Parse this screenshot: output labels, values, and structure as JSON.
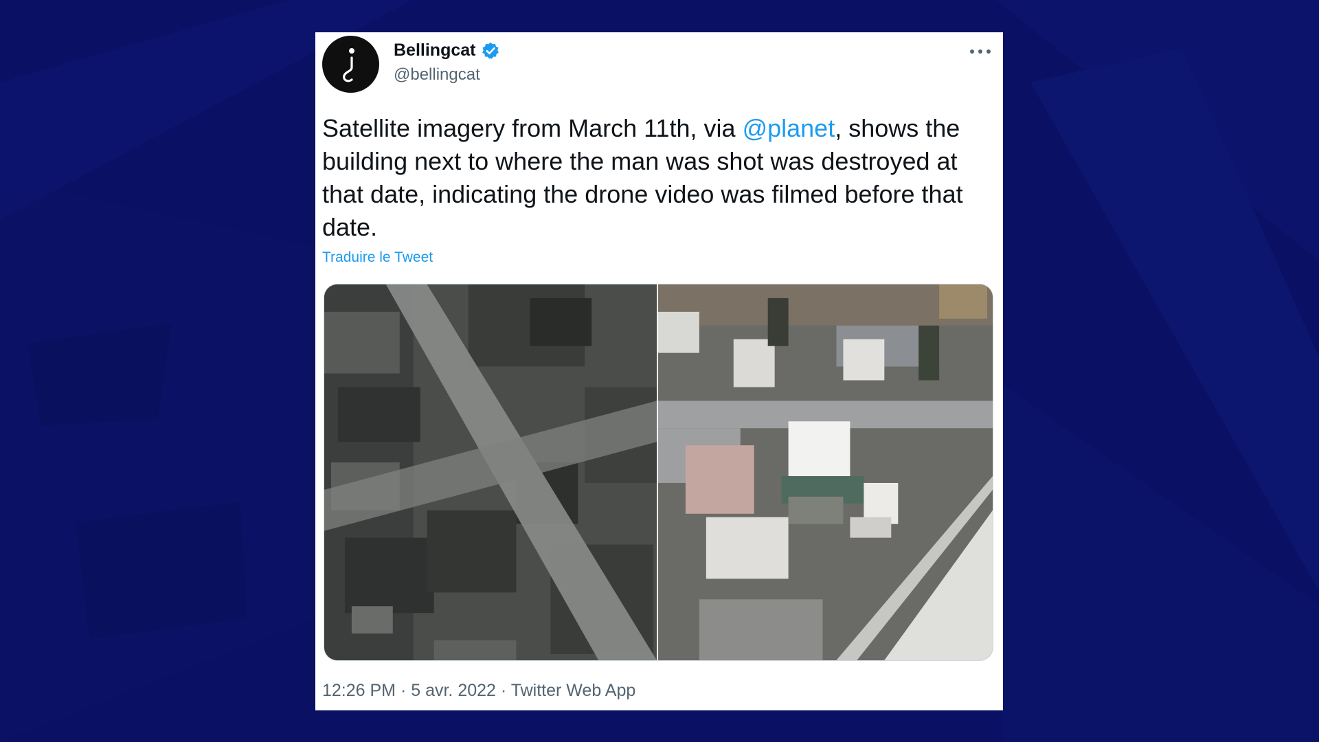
{
  "colors": {
    "page_background": "#0a1063",
    "accent": "#1d9bf0",
    "text_primary": "#0f1419",
    "text_secondary": "#536471"
  },
  "tweet": {
    "author": {
      "display_name": "Bellingcat",
      "handle": "@bellingcat",
      "verified": true,
      "avatar_icon": "question-hook-logo"
    },
    "more_icon": "ellipsis-icon",
    "text_parts": {
      "before_mention": "Satellite imagery from March 11th, via ",
      "mention": "@planet",
      "after_mention": ", shows the building next to where the man was shot was destroyed at that date, indicating the drone video was filmed before that date."
    },
    "translate_label": "Traduire le Tweet",
    "media": [
      {
        "kind": "satellite-image"
      },
      {
        "kind": "drone-video-still"
      }
    ],
    "meta": {
      "time": "12:26 PM",
      "separator_1": " · ",
      "date": "5 avr. 2022",
      "separator_2": " · ",
      "source": "Twitter Web App"
    }
  }
}
